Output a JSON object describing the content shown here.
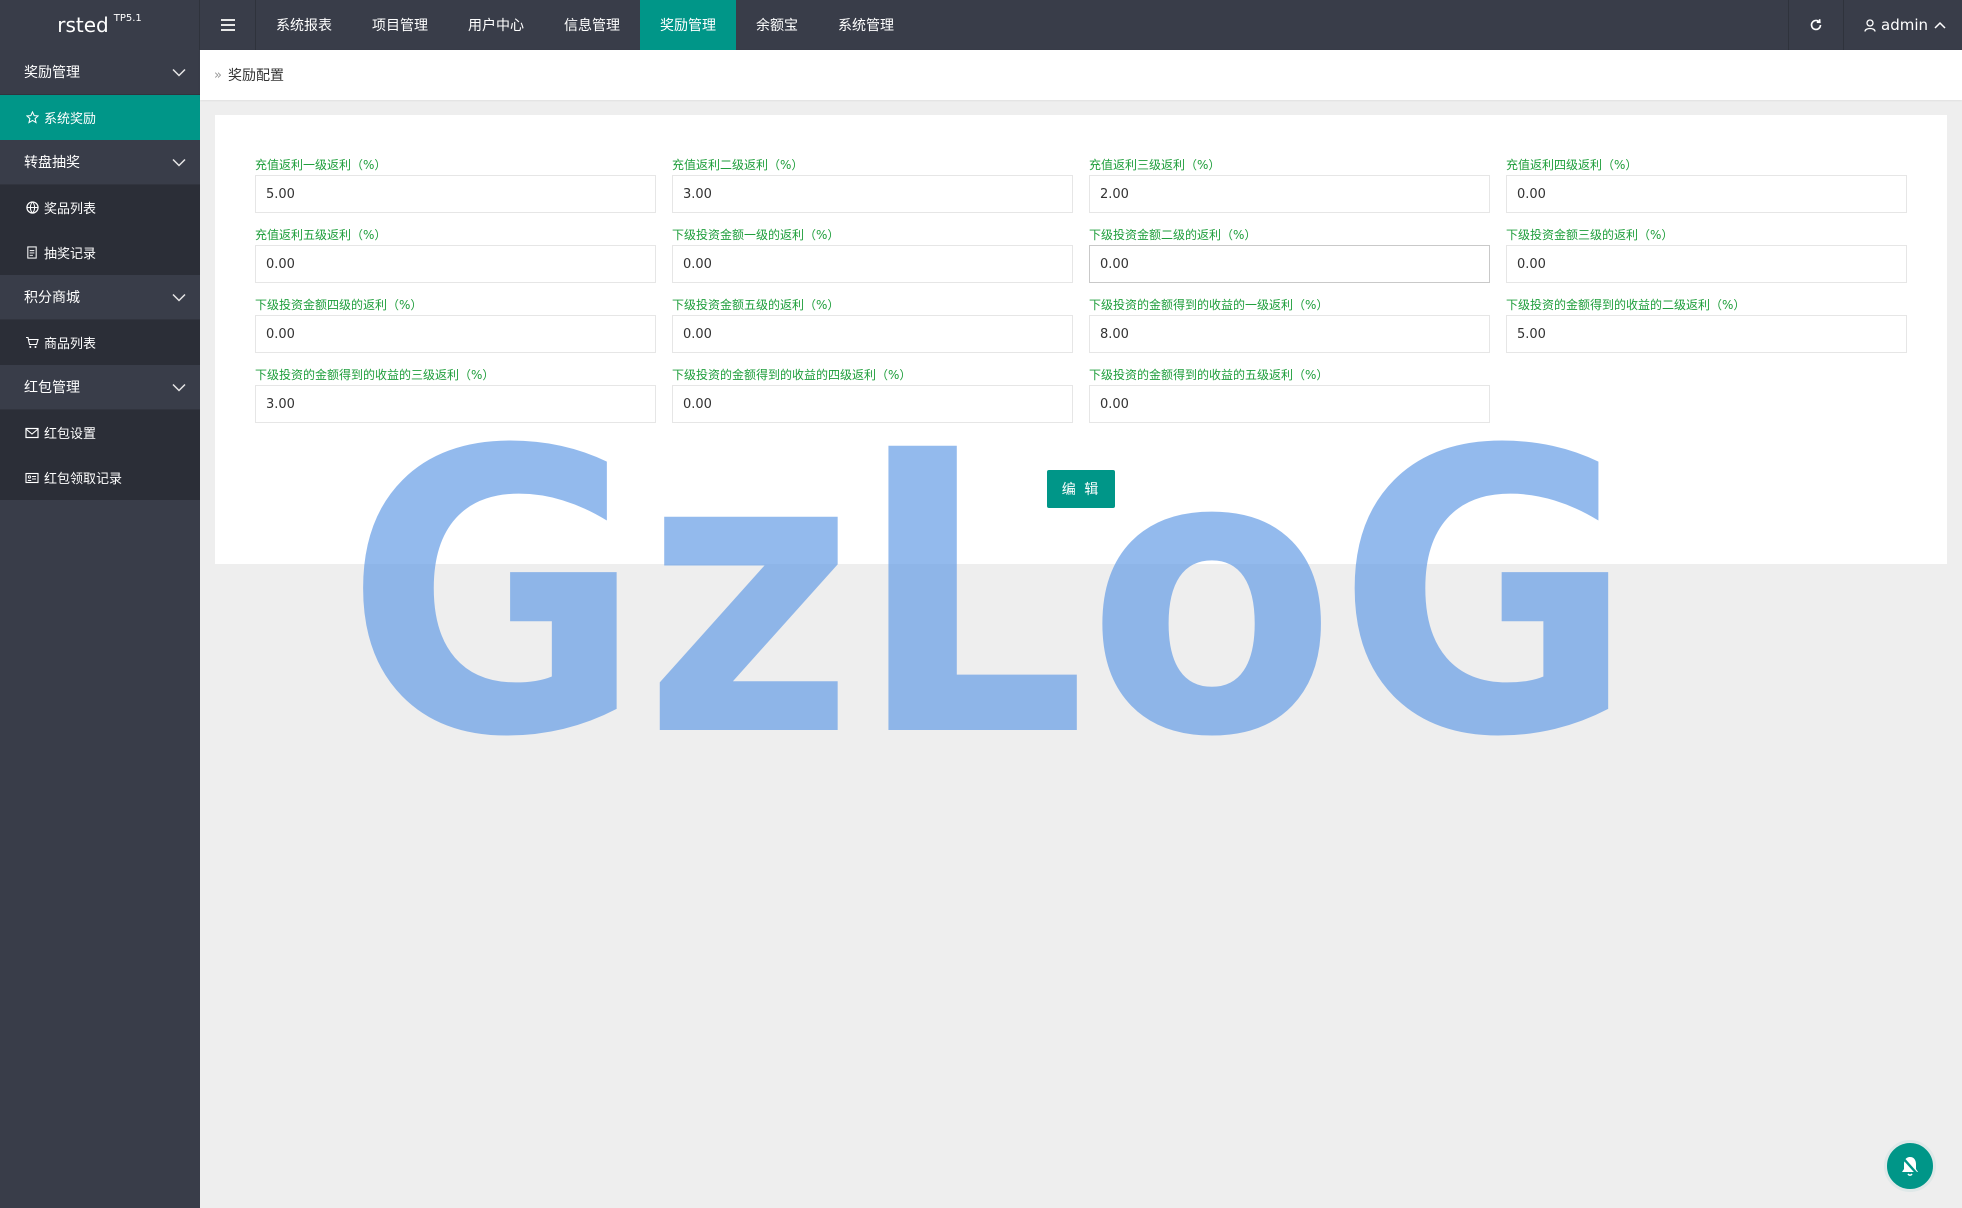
{
  "app": {
    "name": "rsted",
    "version": "TP5.1"
  },
  "topnav": {
    "items": [
      "系统报表",
      "项目管理",
      "用户中心",
      "信息管理",
      "奖励管理",
      "余额宝",
      "系统管理"
    ],
    "active_index": 4
  },
  "user": {
    "name": "admin"
  },
  "sidebar": {
    "groups": [
      {
        "label": "奖励管理",
        "items": [
          {
            "label": "系统奖励",
            "icon": "star-icon",
            "active": true
          }
        ]
      },
      {
        "label": "转盘抽奖",
        "items": [
          {
            "label": "奖品列表",
            "icon": "globe-icon"
          },
          {
            "label": "抽奖记录",
            "icon": "document-icon"
          }
        ]
      },
      {
        "label": "积分商城",
        "items": [
          {
            "label": "商品列表",
            "icon": "cart-icon"
          }
        ]
      },
      {
        "label": "红包管理",
        "items": [
          {
            "label": "红包设置",
            "icon": "envelope-icon"
          },
          {
            "label": "红包领取记录",
            "icon": "card-icon"
          }
        ]
      }
    ]
  },
  "breadcrumb": {
    "current": "奖励配置"
  },
  "form": {
    "fields": [
      {
        "label": "充值返利一级返利（%）",
        "value": "5.00"
      },
      {
        "label": "充值返利二级返利（%）",
        "value": "3.00"
      },
      {
        "label": "充值返利三级返利（%）",
        "value": "2.00"
      },
      {
        "label": "充值返利四级返利（%）",
        "value": "0.00"
      },
      {
        "label": "充值返利五级返利（%）",
        "value": "0.00"
      },
      {
        "label": "下级投资金额一级的返利（%）",
        "value": "0.00"
      },
      {
        "label": "下级投资金额二级的返利（%）",
        "value": "0.00"
      },
      {
        "label": "下级投资金额三级的返利（%）",
        "value": "0.00"
      },
      {
        "label": "下级投资金额四级的返利（%）",
        "value": "0.00"
      },
      {
        "label": "下级投资金额五级的返利（%）",
        "value": "0.00"
      },
      {
        "label": "下级投资的金额得到的收益的一级返利（%）",
        "value": "8.00"
      },
      {
        "label": "下级投资的金额得到的收益的二级返利（%）",
        "value": "5.00"
      },
      {
        "label": "下级投资的金额得到的收益的三级返利（%）",
        "value": "3.00"
      },
      {
        "label": "下级投资的金额得到的收益的四级返利（%）",
        "value": "0.00"
      },
      {
        "label": "下级投资的金额得到的收益的五级返利（%）",
        "value": "0.00"
      }
    ],
    "submit_label": "编 辑"
  },
  "watermark": {
    "text": "GzLoG",
    "color": "#6a9fe6"
  },
  "colors": {
    "accent": "#009688",
    "topbar": "#393d49",
    "sidebar_sub": "#2b2e37",
    "label_green": "#1e9e3b"
  }
}
